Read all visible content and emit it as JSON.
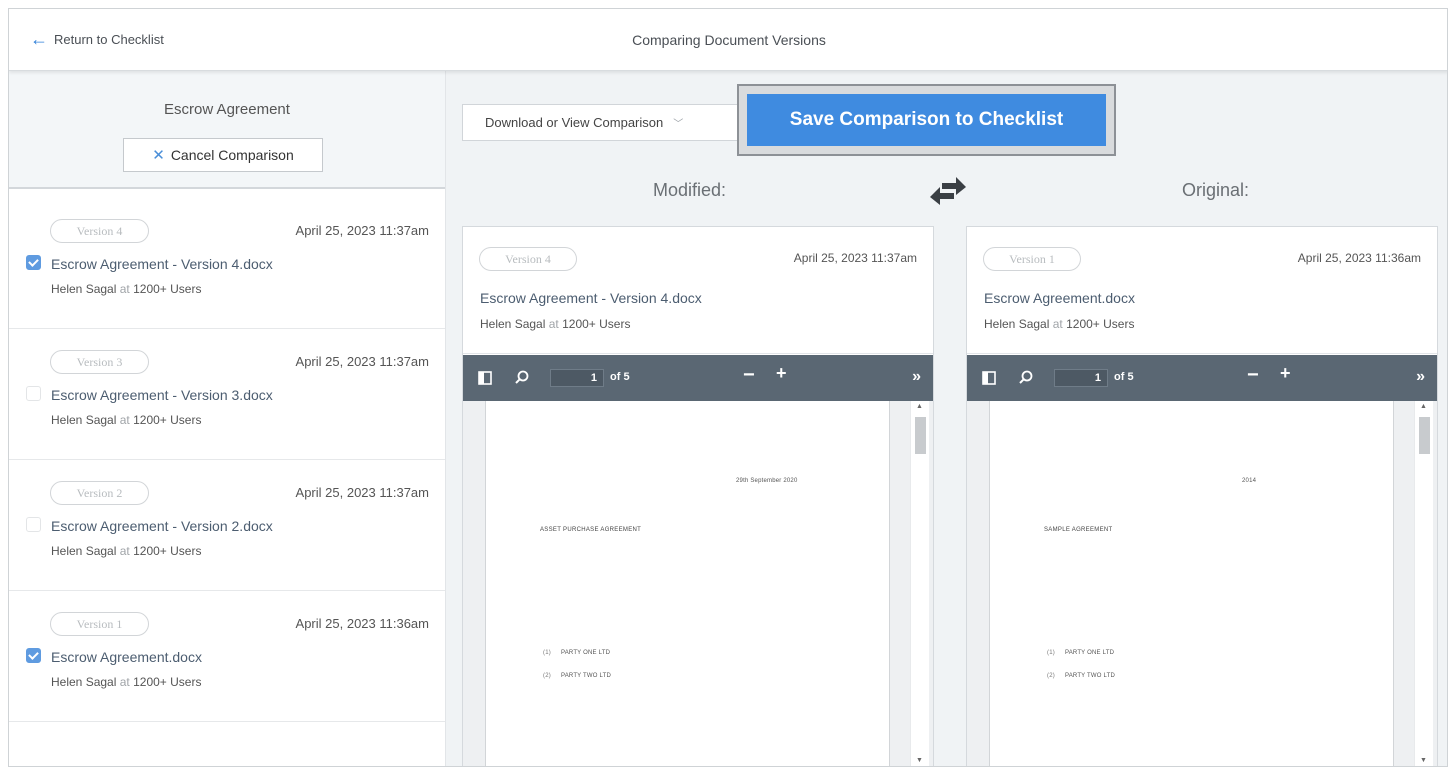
{
  "topbar": {
    "back_label": "Return to Checklist",
    "title": "Comparing Document Versions"
  },
  "sidebar": {
    "document_title": "Escrow Agreement",
    "cancel_label": "Cancel Comparison",
    "versions": [
      {
        "version": "Version 4",
        "date": "April 25, 2023 11:37am",
        "name": "Escrow Agreement - Version 4.docx",
        "author": "Helen Sagal",
        "at": "at",
        "org": "1200+ Users",
        "checked": true
      },
      {
        "version": "Version 3",
        "date": "April 25, 2023 11:37am",
        "name": "Escrow Agreement - Version 3.docx",
        "author": "Helen Sagal",
        "at": "at",
        "org": "1200+ Users",
        "checked": false
      },
      {
        "version": "Version 2",
        "date": "April 25, 2023 11:37am",
        "name": "Escrow Agreement - Version 2.docx",
        "author": "Helen Sagal",
        "at": "at",
        "org": "1200+ Users",
        "checked": false
      },
      {
        "version": "Version 1",
        "date": "April 25, 2023 11:36am",
        "name": "Escrow Agreement.docx",
        "author": "Helen Sagal",
        "at": "at",
        "org": "1200+ Users",
        "checked": true
      }
    ]
  },
  "toolbar": {
    "download_label": "Download or View Comparison",
    "save_label": "Save Comparison to Checklist"
  },
  "columns": {
    "modified_label": "Modified:",
    "original_label": "Original:"
  },
  "panels": {
    "modified": {
      "version": "Version 4",
      "date": "April 25, 2023 11:37am",
      "name": "Escrow Agreement - Version 4.docx",
      "author": "Helen Sagal",
      "at": "at",
      "org": "1200+ Users",
      "page_current": "1",
      "page_total": "of 5",
      "doc_date": "29th September 2020",
      "doc_heading": "ASSET PURCHASE AGREEMENT",
      "party1_num": "(1)",
      "party1": "PARTY ONE LTD",
      "party2_num": "(2)",
      "party2": "PARTY TWO LTD"
    },
    "original": {
      "version": "Version 1",
      "date": "April 25, 2023 11:36am",
      "name": "Escrow Agreement.docx",
      "author": "Helen Sagal",
      "at": "at",
      "org": "1200+ Users",
      "page_current": "1",
      "page_total": "of 5",
      "doc_date": "2014",
      "doc_heading": "SAMPLE AGREEMENT",
      "party1_num": "(1)",
      "party1": "PARTY ONE LTD",
      "party2_num": "(2)",
      "party2": "PARTY TWO LTD"
    }
  },
  "viewer": {
    "minus": "−",
    "plus": "+",
    "more": "»"
  },
  "colors": {
    "accent": "#3f8be0",
    "viewer_bar": "#5a6773",
    "main_bg": "#f0f3f5",
    "sidebar_head_bg": "#f3f6f8"
  },
  "icons": {
    "back": "arrow-left-icon",
    "cancel": "close-icon",
    "dropdown": "chevron-down-icon",
    "swap": "swap-arrows-icon",
    "sidebar_toggle": "sidebar-toggle-icon",
    "search": "search-icon",
    "zoom_out": "minus-icon",
    "zoom_in": "plus-icon",
    "more": "double-chevron-right-icon"
  }
}
